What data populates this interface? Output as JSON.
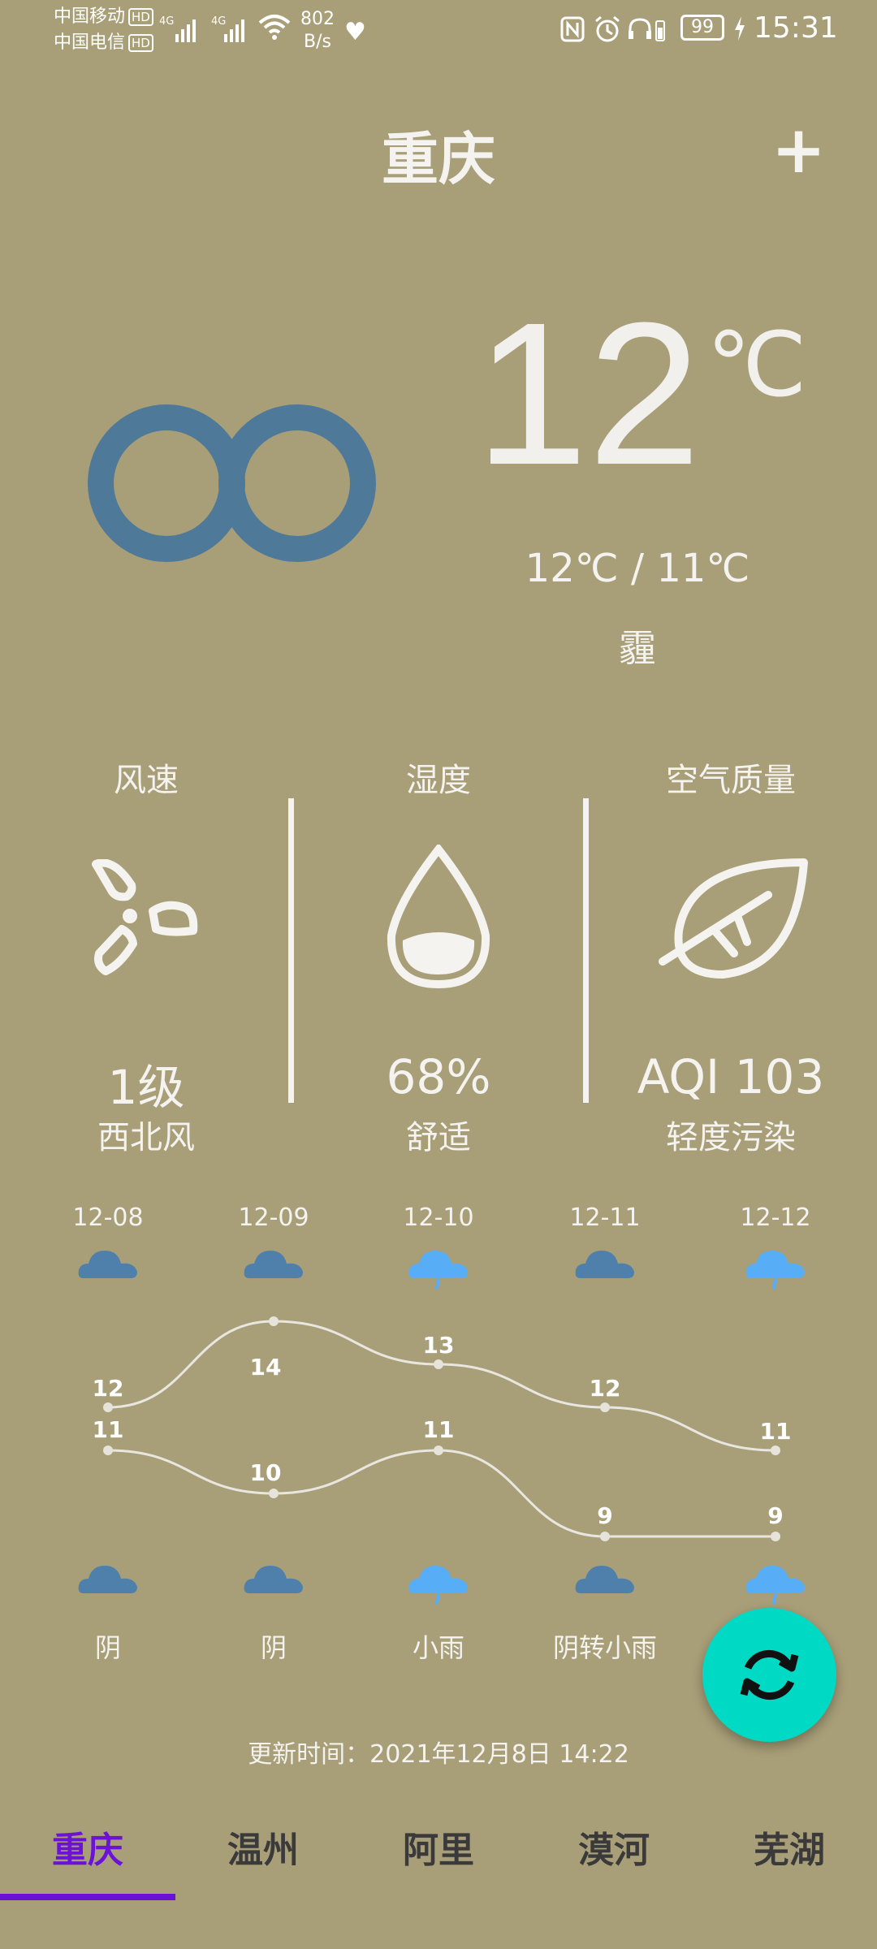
{
  "status_bar": {
    "carrier1": "中国移动",
    "carrier2": "中国电信",
    "hd": "HD",
    "net1": "4G",
    "net2": "4G",
    "speed_value": "802",
    "speed_unit": "B/s",
    "battery": "99",
    "time": "15:31"
  },
  "header": {
    "city": "重庆",
    "add_label": "+"
  },
  "current": {
    "temp": "12",
    "unit": "℃",
    "range": "12℃ / 11℃",
    "condition": "霾"
  },
  "stats": {
    "wind": {
      "label": "风速",
      "value": "1级",
      "sub": "西北风"
    },
    "humidity": {
      "label": "湿度",
      "value": "68%",
      "sub": "舒适"
    },
    "air": {
      "label": "空气质量",
      "value": "AQI 103",
      "sub": "轻度污染"
    }
  },
  "forecast": [
    {
      "date": "12-08",
      "icon": "cloud-icon",
      "high": "12",
      "low": "11",
      "condition": "阴"
    },
    {
      "date": "12-09",
      "icon": "cloud-icon",
      "high": "14",
      "low": "10",
      "condition": "阴"
    },
    {
      "date": "12-10",
      "icon": "rain-cloud-icon",
      "high": "13",
      "low": "11",
      "condition": "小雨"
    },
    {
      "date": "12-11",
      "icon": "cloud-icon",
      "high": "12",
      "low": "9",
      "condition": "阴转小雨"
    },
    {
      "date": "12-12",
      "icon": "rain-cloud-icon",
      "high": "11",
      "low": "9",
      "condition": ""
    }
  ],
  "update_text": "更新时间：2021年12月8日 14:22",
  "tabs": [
    "重庆",
    "温州",
    "阿里",
    "漠河",
    "芜湖"
  ],
  "colors": {
    "background": "#A89E78",
    "haze_icon": "#4F7998",
    "cloud_dark": "#4F80AC",
    "cloud_light": "#57AEF7",
    "fab": "#00D9C4",
    "tab_active": "#6B12D6"
  }
}
